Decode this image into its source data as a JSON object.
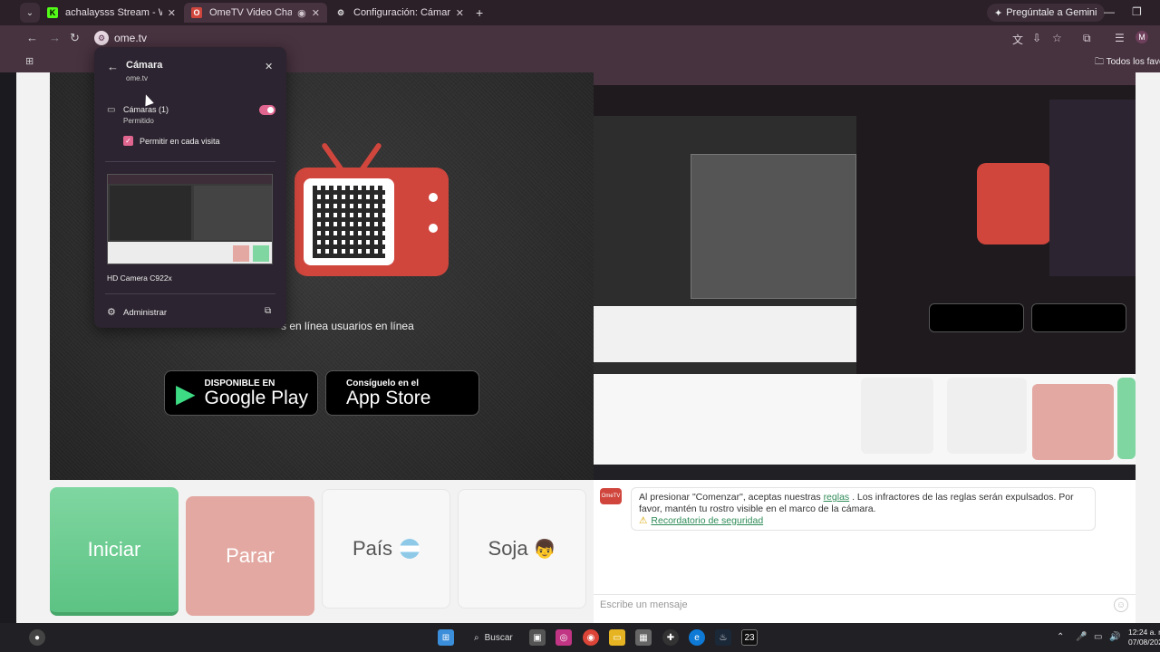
{
  "browser": {
    "tabs": [
      {
        "title": "achalaysss Stream - Watch Live",
        "favicon": "K"
      },
      {
        "title": "OmeTV Video Chat — Altern",
        "favicon": "O"
      },
      {
        "title": "Configuración: Cámara",
        "favicon": "⚙"
      }
    ],
    "gemini_label": "Pregúntale a Gemini",
    "url": "ome.tv",
    "profile_initial": "M",
    "bookmarks_folder": "Todos los favori"
  },
  "permission_popup": {
    "title": "Cámara",
    "host": "ome.tv",
    "cameras_label": "Cámaras (1)",
    "cameras_status": "Permitido",
    "checkbox_label": "Permitir en cada visita",
    "device_name": "HD Camera C922x",
    "manage_label": "Administrar"
  },
  "video": {
    "online_text": "s en línea usuarios en línea",
    "google_play": {
      "small": "DISPONIBLE EN",
      "big": "Google Play"
    },
    "app_store": {
      "small": "Consíguelo en el",
      "big": "App Store"
    }
  },
  "controls": {
    "start": "Iniciar",
    "stop": "Parar",
    "country": "País",
    "gender": "Soja"
  },
  "chat": {
    "message_part1": "Al presionar \"Comenzar\", aceptas nuestras",
    "rules_link": "reglas",
    "message_part2": ". Los infractores de las reglas serán expulsados. Por favor, mantén tu rostro visible en el marco de la cámara.",
    "safety_link": "Recordatorio de seguridad",
    "input_placeholder": "Escribe un mensaje"
  },
  "taskbar": {
    "search_label": "Buscar",
    "time": "12:24 a. m.",
    "date": "07/08/2025",
    "badge": "23"
  },
  "colors": {
    "accent_pink": "#e0658f",
    "start_green": "#5cc384",
    "stop_red": "#e3a8a1",
    "brand_red": "#d0463d"
  }
}
